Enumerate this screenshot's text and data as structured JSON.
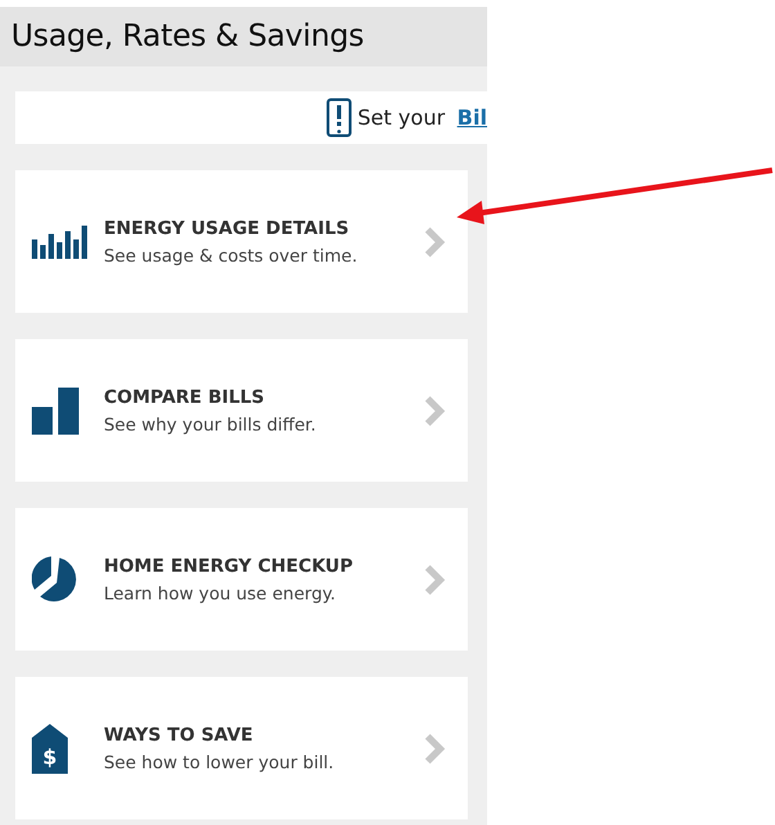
{
  "header": {
    "title": "Usage, Rates & Savings"
  },
  "banner": {
    "text": "Set your ",
    "link": "Bil"
  },
  "items": [
    {
      "kind": "usage",
      "title": "ENERGY USAGE DETAILS",
      "subtitle": "See usage & costs over time."
    },
    {
      "kind": "compare",
      "title": "COMPARE BILLS",
      "subtitle": "See why your bills differ."
    },
    {
      "kind": "pie",
      "title": "HOME ENERGY CHECKUP",
      "subtitle": "Learn how you use energy."
    },
    {
      "kind": "tag",
      "glyph": "$",
      "title": "WAYS TO SAVE",
      "subtitle": "See how to lower your bill."
    }
  ]
}
